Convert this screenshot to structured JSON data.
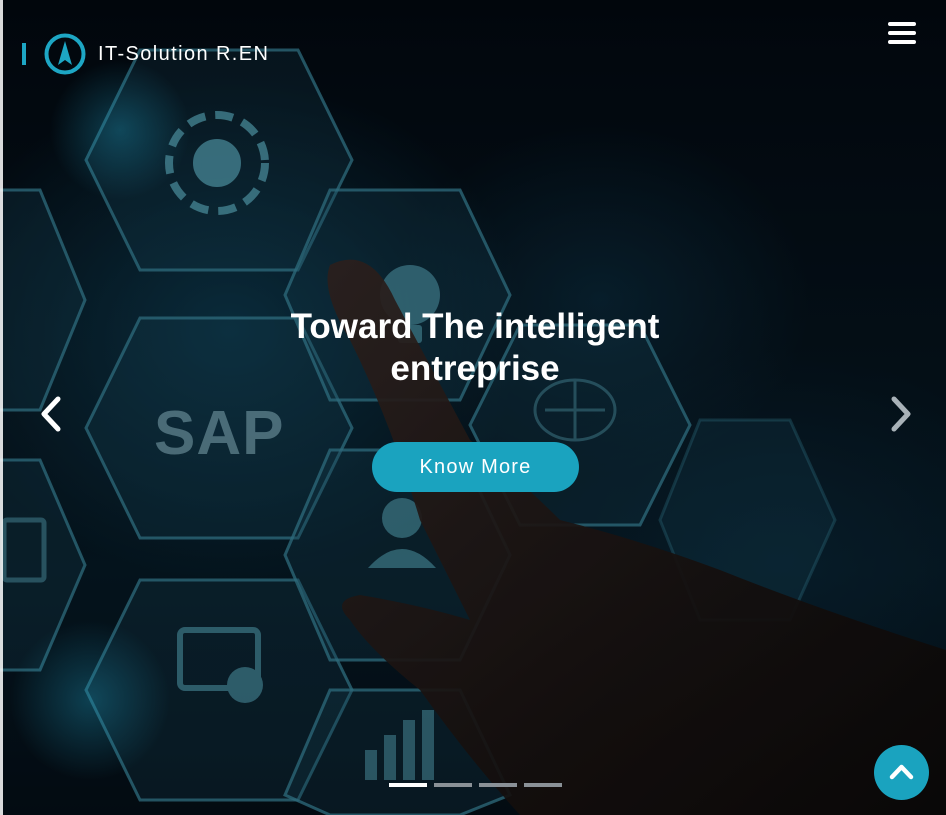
{
  "brand": {
    "name": "IT-Solution R.EN",
    "logo_icon": "ring-logo-icon",
    "accent": "#1da6c4"
  },
  "header": {
    "menu_icon": "hamburger-menu-icon"
  },
  "hero": {
    "title_line1": "Toward The intelligent",
    "title_line2": "entreprise",
    "cta_label": "Know More",
    "cta_color": "#1aa3bf",
    "background_text": "SAP",
    "prev_icon": "chevron-left-icon",
    "next_icon": "chevron-right-icon"
  },
  "carousel": {
    "slide_count": 4,
    "active_index": 0
  },
  "scroll_top": {
    "icon": "chevron-up-icon"
  }
}
